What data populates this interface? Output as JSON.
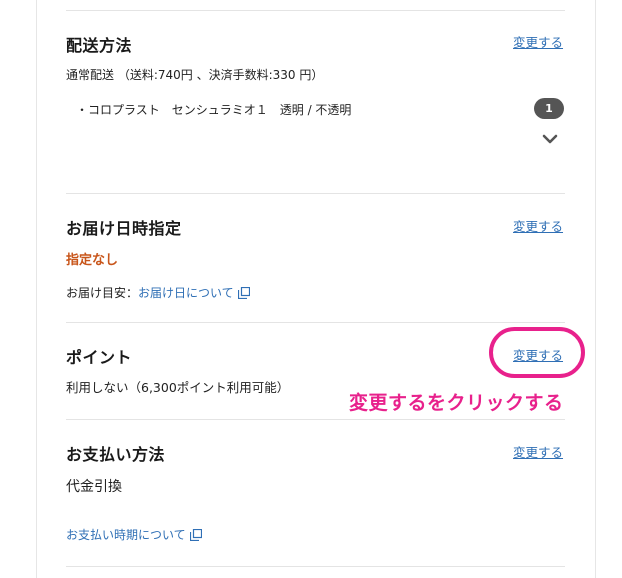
{
  "shipping": {
    "title": "配送方法",
    "change_label": "変更する",
    "method": "通常配送 （送料:740円 、決済手数料:330 円）",
    "item": "・コロプラスト　センシュラミオ１　透明 / 不透明",
    "quantity": "1",
    "expand_icon": "chevron-down-icon"
  },
  "delivery": {
    "title": "お届け日時指定",
    "change_label": "変更する",
    "value": "指定なし",
    "estimate_label": "お届け目安：",
    "estimate_link": "お届け日について"
  },
  "points": {
    "title": "ポイント",
    "change_label": "変更する",
    "value": "利用しない（6,300ポイント利用可能）"
  },
  "annotation": {
    "text": "変更するをクリックする",
    "color": "#e8218c"
  },
  "payment": {
    "title": "お支払い方法",
    "change_label": "変更する",
    "value": "代金引換",
    "timing_link": "お支払い時期について"
  },
  "colors": {
    "link": "#2f6fb5",
    "warning": "#c8551a",
    "highlight": "#e8218c"
  }
}
